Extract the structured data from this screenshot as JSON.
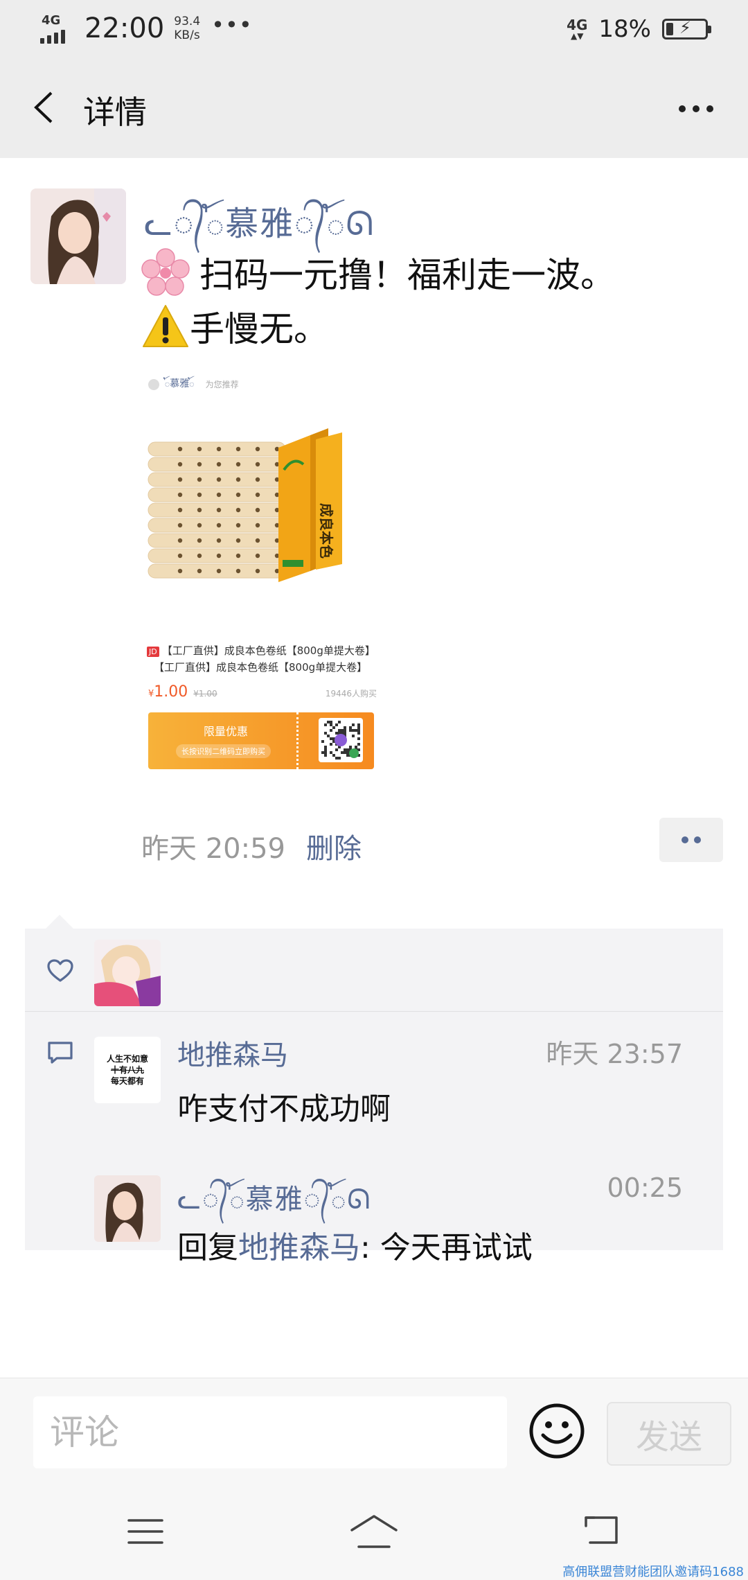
{
  "status_bar": {
    "network_left": "4G",
    "time": "22:00",
    "speed_value": "93.4",
    "speed_unit": "KB/s",
    "network_right": "4G",
    "battery_percent": "18%",
    "battery_level": 0.18
  },
  "nav": {
    "title": "详情"
  },
  "post": {
    "author": "ℒ✠⧿慕雅⧿✠ℓ",
    "author_display": "ᓚ᭄ꪳ慕雅᭄ꪳᘏ",
    "text_line1": "扫码一元撸！福利走一波。",
    "text_line2": "手慢无。",
    "time": "昨天 20:59",
    "delete_label": "删除",
    "product": {
      "sharer": "ꪳ慕雅ꪳ",
      "recommend": "为您推荐",
      "badge": "JD",
      "title1": "【工厂直供】成良本色卷纸【800g单提大卷】",
      "title2": "【工厂直供】成良本色卷纸【800g单提大卷】",
      "currency": "¥",
      "price": "1.00",
      "old_price": "¥1.00",
      "buyers": "19446人购买",
      "coupon_title": "限量优惠",
      "coupon_sub": "长按识别二维码立即购买"
    }
  },
  "interactions": {
    "comments": [
      {
        "name": "地推森马",
        "time": "昨天 23:57",
        "text": "咋支付不成功啊",
        "avatar_lines": [
          "人生不如意",
          "十有八九",
          "每天都有"
        ]
      },
      {
        "name": "ᓚ᭄ꪳ慕雅᭄ꪳᘏ",
        "time": "00:25",
        "reply_prefix": "回复",
        "reply_target": "地推森马",
        "reply_text": ": 今天再试试"
      }
    ]
  },
  "input_bar": {
    "placeholder": "评论",
    "send_label": "发送"
  },
  "watermark": "高佣联盟营财能团队邀请码1688",
  "colors": {
    "link": "#576b95",
    "bar_bg": "#ededed",
    "price": "#f05a28"
  }
}
